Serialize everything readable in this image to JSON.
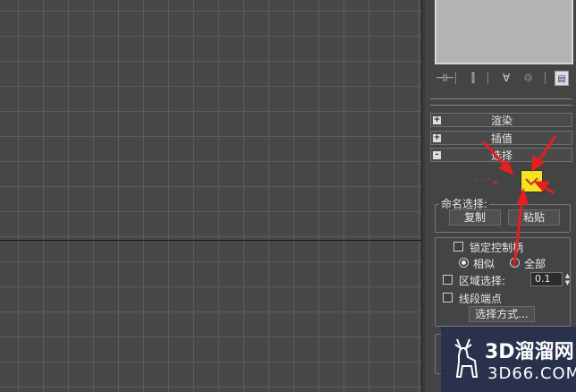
{
  "toolbar": {
    "icons": [
      "pin-stack-icon",
      "show-end-result-icon",
      "make-unique-icon",
      "remove-modifier-icon",
      "configure-modifier-sets-icon"
    ]
  },
  "rollouts": [
    {
      "sign": "+",
      "title": "渲染"
    },
    {
      "sign": "+",
      "title": "插值"
    },
    {
      "sign": "-",
      "title": "选择"
    }
  ],
  "selection": {
    "level_text": "ᐟ⁻ᐟ∞",
    "named_selection": {
      "label": "命名选择:",
      "copy_label": "复制",
      "paste_label": "粘贴"
    },
    "lock_handles_label": "锁定控制柄",
    "similar_label": "相似",
    "all_label": "全部",
    "area_selection_label": "区域选择:",
    "area_threshold": "0.1",
    "segment_end_label": "线段端点",
    "select_by_label": "选择方式..."
  },
  "watermark": {
    "brand": "3D溜溜网",
    "domain": "3D66.COM"
  },
  "colors": {
    "accent_yellow": "#f5e31d",
    "arrow_red": "#e81e1e"
  }
}
